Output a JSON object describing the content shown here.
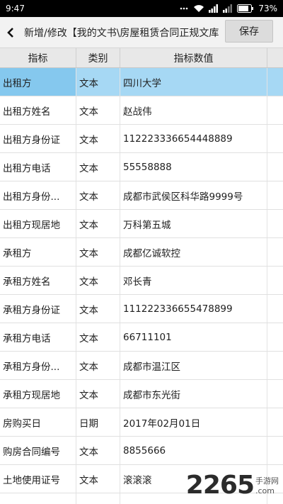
{
  "status_bar": {
    "time": "9:47",
    "battery": "73%"
  },
  "toolbar": {
    "title": "新增/修改【我的文书\\房屋租赁合同正规文库",
    "save_label": "保存"
  },
  "table": {
    "headers": [
      "指标",
      "类别",
      "指标数值"
    ],
    "rows": [
      {
        "name": "出租方",
        "type": "文本",
        "value": "四川大学"
      },
      {
        "name": "出租方姓名",
        "type": "文本",
        "value": "赵战伟"
      },
      {
        "name": "出租方身份证",
        "type": "文本",
        "value": "112223336654448889"
      },
      {
        "name": "出租方电话",
        "type": "文本",
        "value": "55558888"
      },
      {
        "name": "出租方身份...",
        "type": "文本",
        "value": "成都市武侯区科华路9999号"
      },
      {
        "name": "出租方现居地",
        "type": "文本",
        "value": "万科第五城"
      },
      {
        "name": "承租方",
        "type": "文本",
        "value": "成都亿诚软控"
      },
      {
        "name": "承租方姓名",
        "type": "文本",
        "value": "邓长青"
      },
      {
        "name": "承租方身份证",
        "type": "文本",
        "value": "111222336655478899"
      },
      {
        "name": "承租方电话",
        "type": "文本",
        "value": "66711101"
      },
      {
        "name": "承租方身份...",
        "type": "文本",
        "value": "成都市温江区"
      },
      {
        "name": "承租方现居地",
        "type": "文本",
        "value": "成都市东光街"
      },
      {
        "name": "房购买日",
        "type": "日期",
        "value": "2017年02月01日"
      },
      {
        "name": "购房合同编号",
        "type": "文本",
        "value": "8855666"
      },
      {
        "name": "土地使用证号",
        "type": "文本",
        "value": "滚滚滚"
      },
      {
        "name": "",
        "type": "",
        "value": ""
      }
    ]
  },
  "watermark": {
    "number": "2265",
    "site": ".com",
    "sub": "手游网"
  },
  "colors": {
    "selected_row": "#a6d8f4",
    "selected_cell": "#85c8ee",
    "watermark_accent": "#17b3e8"
  }
}
